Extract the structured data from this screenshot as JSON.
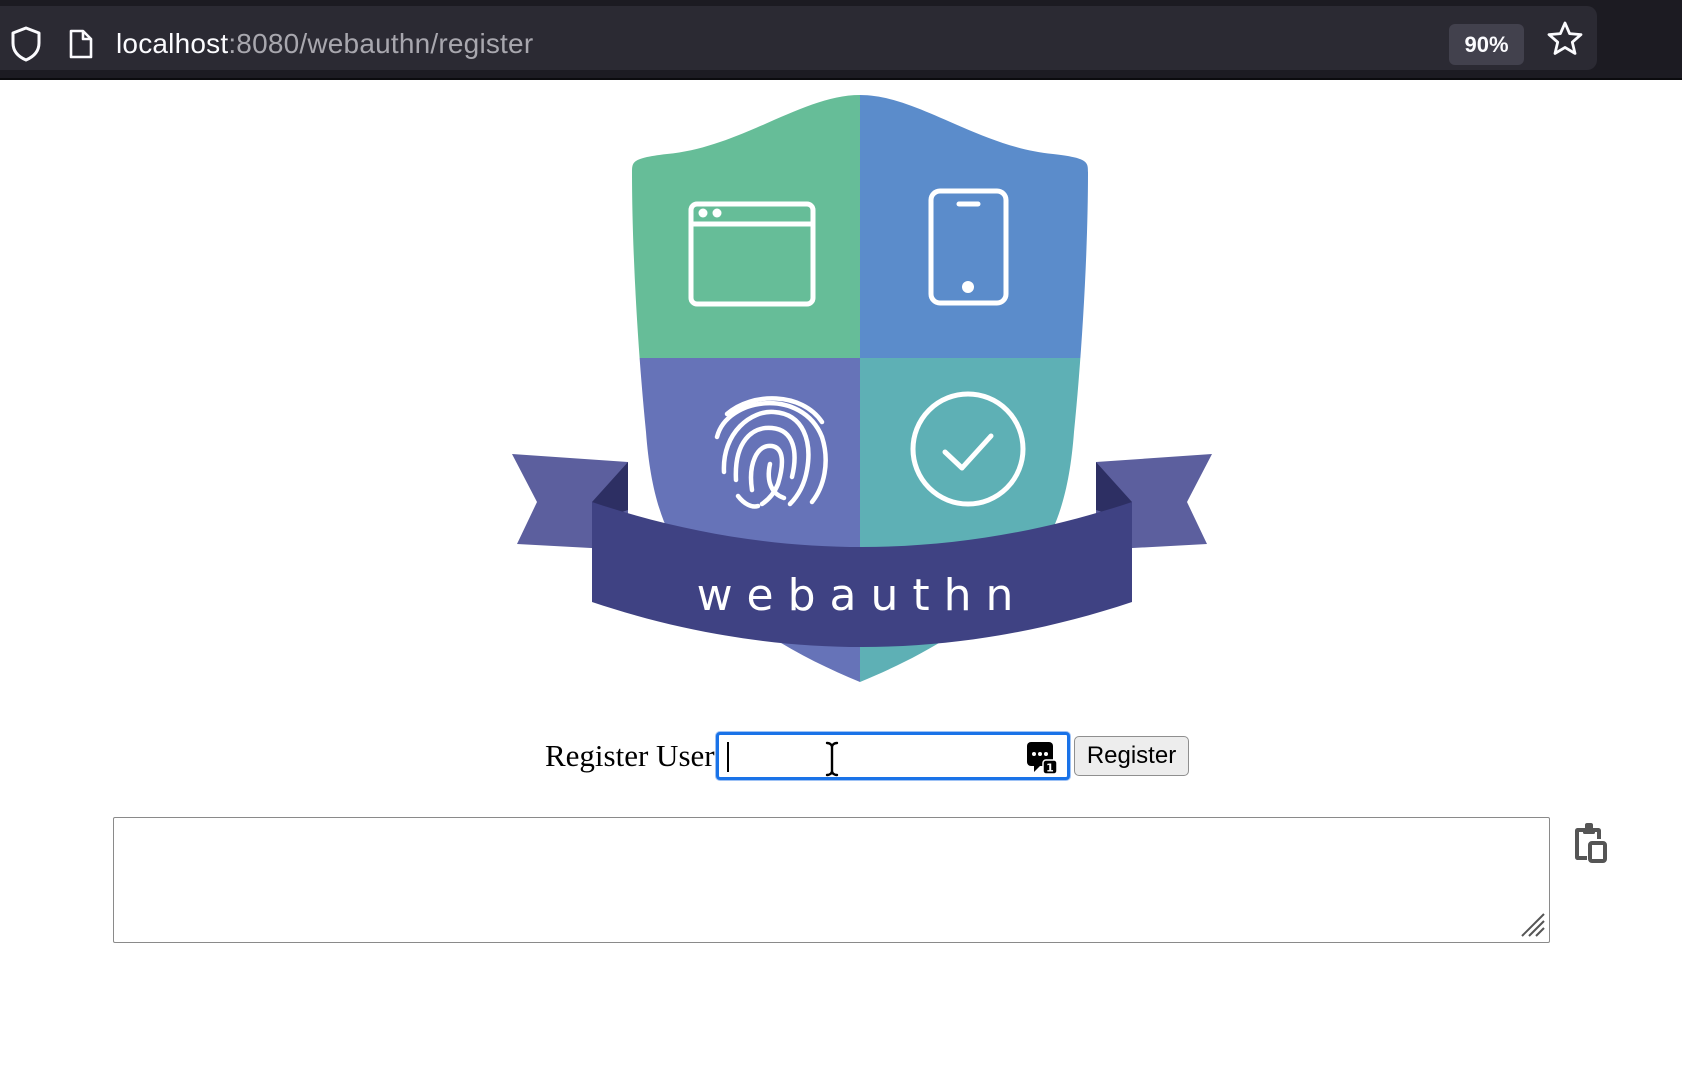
{
  "browser": {
    "url_host": "localhost",
    "url_path": ":8080/webauthn/register",
    "zoom": "90%",
    "icons": {
      "tracking_protection": "shield-icon",
      "page_info": "page-icon",
      "bookmark": "star-icon"
    }
  },
  "logo": {
    "text": "webauthn",
    "colors": {
      "green": "#66bd98",
      "blue": "#5b8ccb",
      "purple": "#6673b8",
      "teal": "#5eb0b5",
      "ribbon": "#3f4283",
      "ribbon_tail": "#5c5f9e"
    },
    "icons": [
      "browser-window-icon",
      "phone-icon",
      "fingerprint-icon",
      "checkmark-icon"
    ]
  },
  "register": {
    "label": "Register User:",
    "input_value": "",
    "button_label": "Register",
    "focus_color": "#1a73e8"
  },
  "output": {
    "value": ""
  }
}
